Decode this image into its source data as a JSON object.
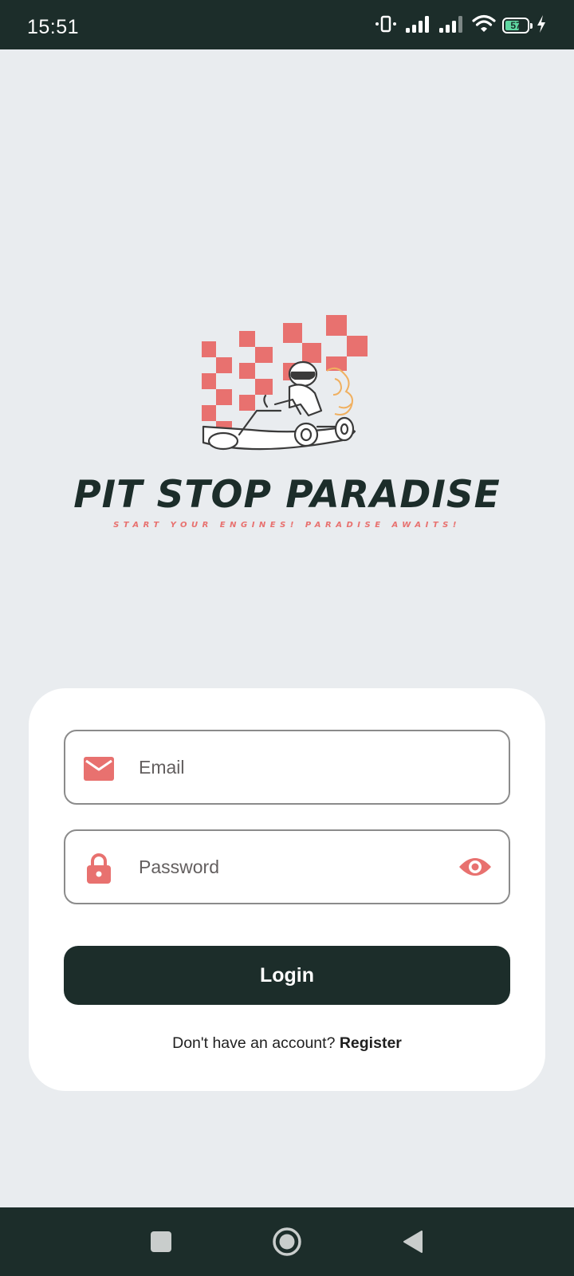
{
  "status_bar": {
    "time": "15:51",
    "battery_level": "57",
    "icons": [
      "vibrate-icon",
      "signal-icon",
      "signal-icon",
      "wifi-icon",
      "battery-icon",
      "charging-icon"
    ]
  },
  "brand": {
    "title": "PIT STOP PARADISE",
    "tagline": "START YOUR ENGINES! PARADISE AWAITS!",
    "logo_icon": "checkered-flag-go-kart-logo"
  },
  "form": {
    "email_placeholder": "Email",
    "email_value": "",
    "email_icon": "mail-icon",
    "password_placeholder": "Password",
    "password_value": "",
    "password_icon": "lock-icon",
    "visibility_icon": "eye-icon",
    "login_label": "Login",
    "register_prompt": "Don't have an account?",
    "register_label": "Register"
  },
  "nav_bar": {
    "recents_icon": "square-icon",
    "home_icon": "circle-icon",
    "back_icon": "triangle-back-icon"
  },
  "colors": {
    "primary_dark": "#1c2d2a",
    "accent": "#e8716f",
    "background": "#e9ecef"
  }
}
